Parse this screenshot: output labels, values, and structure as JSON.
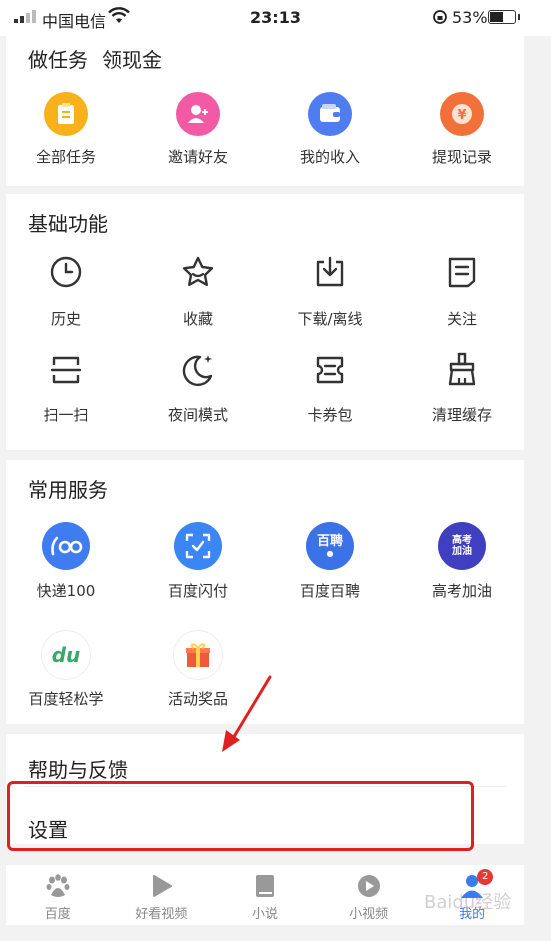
{
  "status_bar": {
    "carrier": "中国电信",
    "time": "23:13",
    "battery": "53%",
    "battery_level": 0.53
  },
  "tasks": {
    "title_left": "做任务",
    "title_right": "领现金",
    "items": [
      {
        "label": "全部任务",
        "icon": "clipboard-icon",
        "color": "#f7b21b"
      },
      {
        "label": "邀请好友",
        "icon": "invite-user-icon",
        "color": "#f25aa5"
      },
      {
        "label": "我的收入",
        "icon": "wallet-icon",
        "color": "#4d7df0"
      },
      {
        "label": "提现记录",
        "icon": "coin-icon",
        "color": "#f2703a"
      }
    ]
  },
  "basic": {
    "title": "基础功能",
    "items": [
      {
        "label": "历史",
        "icon": "clock-icon"
      },
      {
        "label": "收藏",
        "icon": "star-icon"
      },
      {
        "label": "下载/离线",
        "icon": "download-icon"
      },
      {
        "label": "关注",
        "icon": "note-icon"
      },
      {
        "label": "扫一扫",
        "icon": "scan-icon"
      },
      {
        "label": "夜间模式",
        "icon": "moon-icon"
      },
      {
        "label": "卡券包",
        "icon": "coupon-icon"
      },
      {
        "label": "清理缓存",
        "icon": "broom-icon"
      }
    ]
  },
  "services": {
    "title": "常用服务",
    "items": [
      {
        "label": "快递100",
        "icon": "kuaidi100-icon",
        "color": "#3e7cf0",
        "glyph": "(CO"
      },
      {
        "label": "百度闪付",
        "icon": "scan-pay-icon",
        "color": "#3a86f5",
        "glyph": ""
      },
      {
        "label": "百度百聘",
        "icon": "baipin-icon",
        "color": "#3b72e8",
        "glyph": "百聘"
      },
      {
        "label": "高考加油",
        "icon": "gaokao-icon",
        "color": "#3f3fbf",
        "glyph": "高考加油"
      },
      {
        "label": "百度轻松学",
        "icon": "du-learn-icon",
        "color": "#ffffff",
        "glyph": "du"
      },
      {
        "label": "活动奖品",
        "icon": "gift-icon",
        "color": "#ffffff",
        "glyph": ""
      }
    ]
  },
  "help": {
    "title": "帮助与反馈",
    "settings": "设置"
  },
  "tabbar": {
    "tabs": [
      {
        "label": "百度",
        "icon": "baidu-paw-icon"
      },
      {
        "label": "好看视频",
        "icon": "play-icon"
      },
      {
        "label": "小说",
        "icon": "book-icon"
      },
      {
        "label": "小视频",
        "icon": "video-icon"
      },
      {
        "label": "我的",
        "icon": "profile-icon",
        "badge": "2"
      }
    ]
  },
  "watermark": "Baidu经验"
}
